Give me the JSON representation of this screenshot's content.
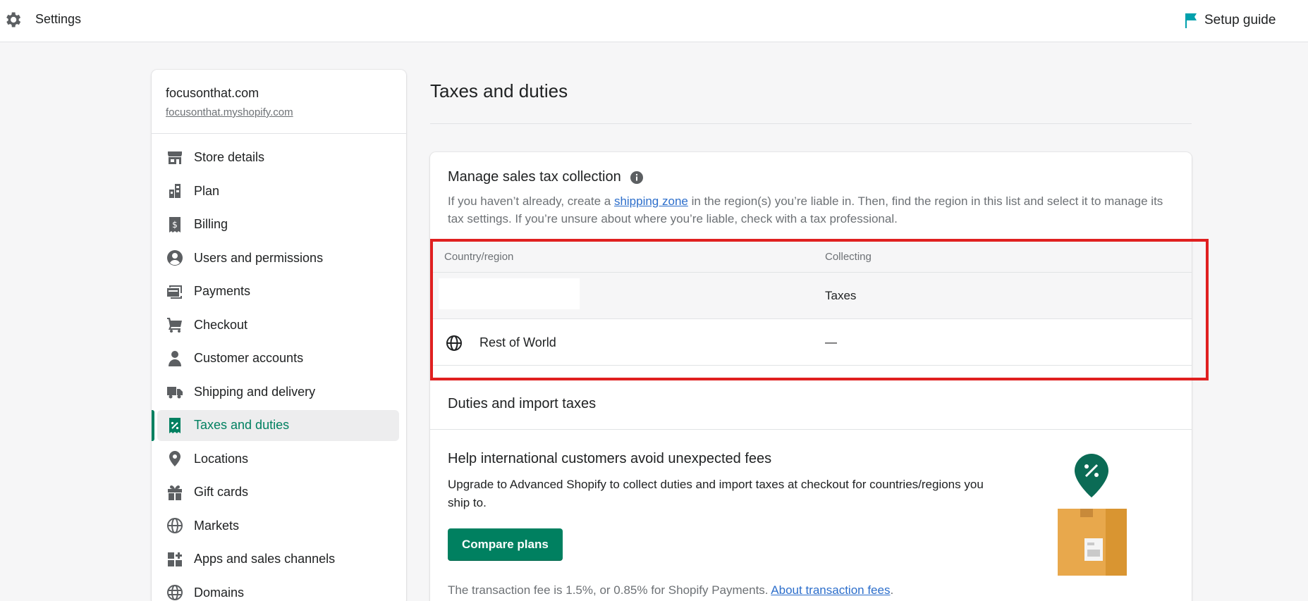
{
  "topbar": {
    "title": "Settings",
    "setup_label": "Setup guide"
  },
  "store": {
    "name": "focusonthat.com",
    "url": "focusonthat.myshopify.com"
  },
  "sidebar": {
    "items": [
      {
        "label": "Store details",
        "icon": "store-icon"
      },
      {
        "label": "Plan",
        "icon": "plan-icon"
      },
      {
        "label": "Billing",
        "icon": "billing-icon"
      },
      {
        "label": "Users and permissions",
        "icon": "user-circle-icon"
      },
      {
        "label": "Payments",
        "icon": "payments-icon"
      },
      {
        "label": "Checkout",
        "icon": "cart-icon"
      },
      {
        "label": "Customer accounts",
        "icon": "person-icon"
      },
      {
        "label": "Shipping and delivery",
        "icon": "truck-icon"
      },
      {
        "label": "Taxes and duties",
        "icon": "tax-icon",
        "active": true
      },
      {
        "label": "Locations",
        "icon": "location-icon"
      },
      {
        "label": "Gift cards",
        "icon": "gift-icon"
      },
      {
        "label": "Markets",
        "icon": "globe-icon"
      },
      {
        "label": "Apps and sales channels",
        "icon": "apps-icon"
      },
      {
        "label": "Domains",
        "icon": "domain-icon"
      }
    ]
  },
  "main": {
    "title": "Taxes and duties",
    "sales_tax": {
      "heading": "Manage sales tax collection",
      "desc_before": "If you haven’t already, create a ",
      "desc_link": "shipping zone",
      "desc_after": " in the region(s) you’re liable in. Then, find the region in this list and select it to manage its tax settings. If you’re unsure about where you’re liable, check with a tax professional.",
      "col_region": "Country/region",
      "col_collecting": "Collecting",
      "rows": [
        {
          "name": "",
          "collecting": "Taxes"
        },
        {
          "name": "Rest of World",
          "collecting": "—"
        }
      ]
    },
    "duties": {
      "heading": "Duties and import taxes",
      "help_heading": "Help international customers avoid unexpected fees",
      "help_text": "Upgrade to Advanced Shopify to collect duties and import taxes at checkout for countries/regions you ship to.",
      "button": "Compare plans",
      "fee_text": "The transaction fee is 1.5%, or 0.85% for Shopify Payments. ",
      "fee_link": "About transaction fees",
      "fee_end": "."
    }
  },
  "colors": {
    "accent": "#008060",
    "link": "#2c6ecb",
    "highlight": "#e02020",
    "flag": "#00a0ac"
  }
}
